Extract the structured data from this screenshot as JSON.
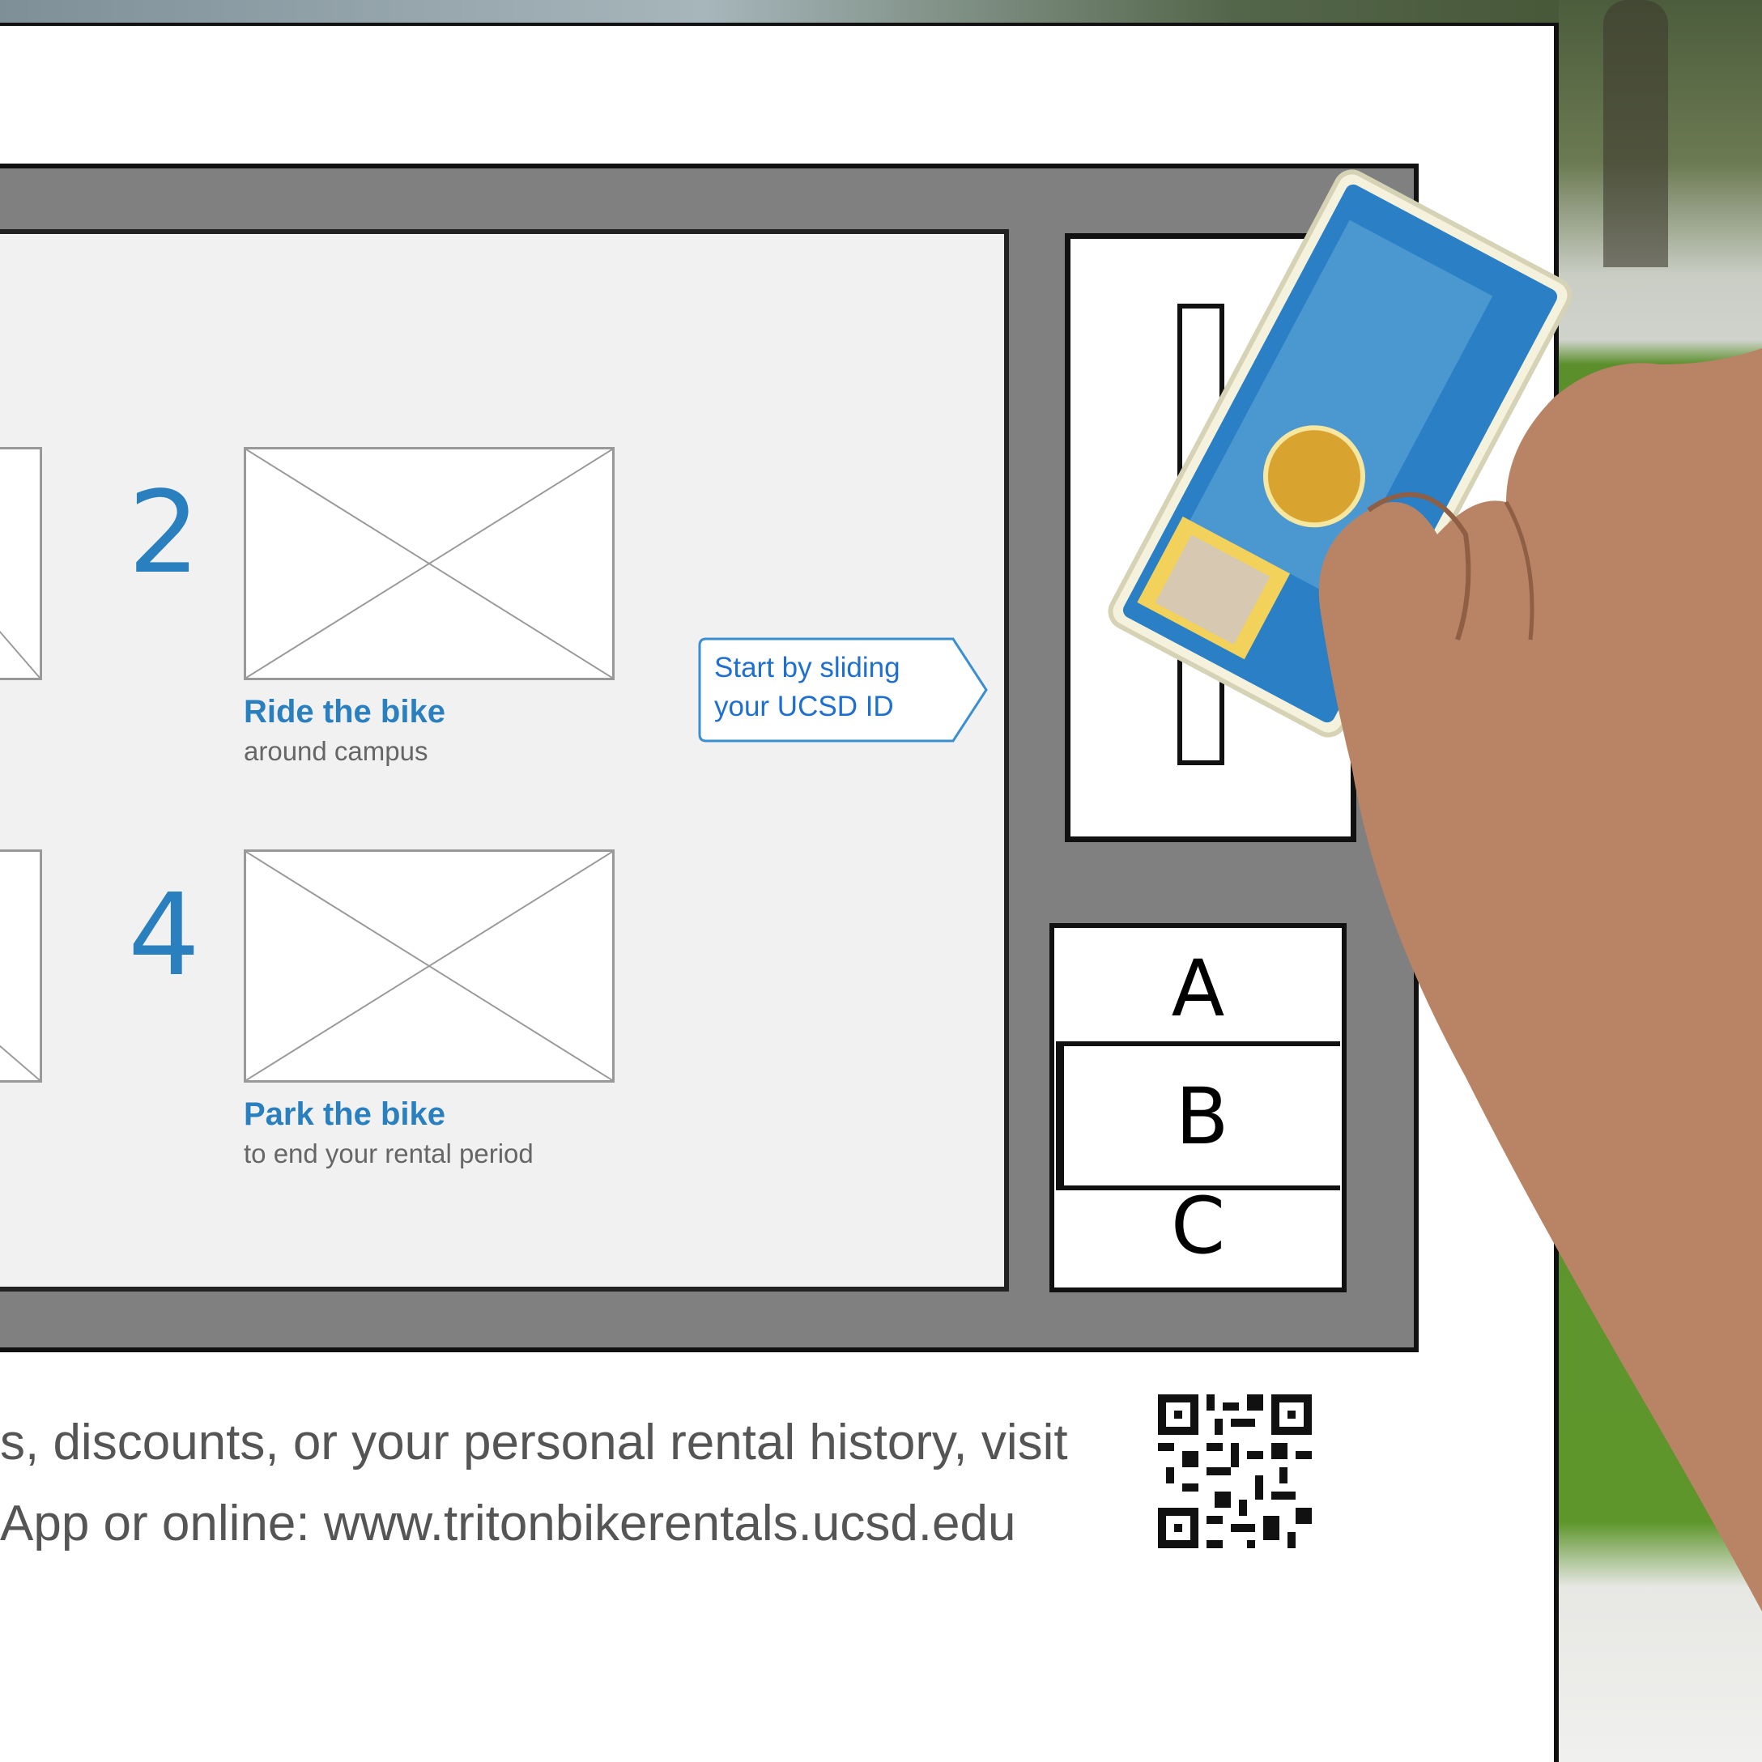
{
  "kiosk": {
    "steps": [
      {
        "number": "2",
        "title": "Ride the bike",
        "subtitle": "around campus"
      },
      {
        "number": "4",
        "title": "Park the bike",
        "subtitle": "to end your rental period"
      }
    ],
    "callout": "Start by sliding your UCSD ID",
    "options": [
      "A",
      "B",
      "C"
    ]
  },
  "footer": {
    "line1": "s, discounts, or your personal rental history, visit",
    "line2": "App or online: www.tritonbikerentals.ucsd.edu"
  },
  "colors": {
    "accent": "#2a80bf",
    "kiosk_frame": "#808080",
    "screen_bg": "#f1f1f1"
  },
  "icons": {
    "placeholder": "image-placeholder-icon",
    "qr": "qr-code-icon"
  }
}
